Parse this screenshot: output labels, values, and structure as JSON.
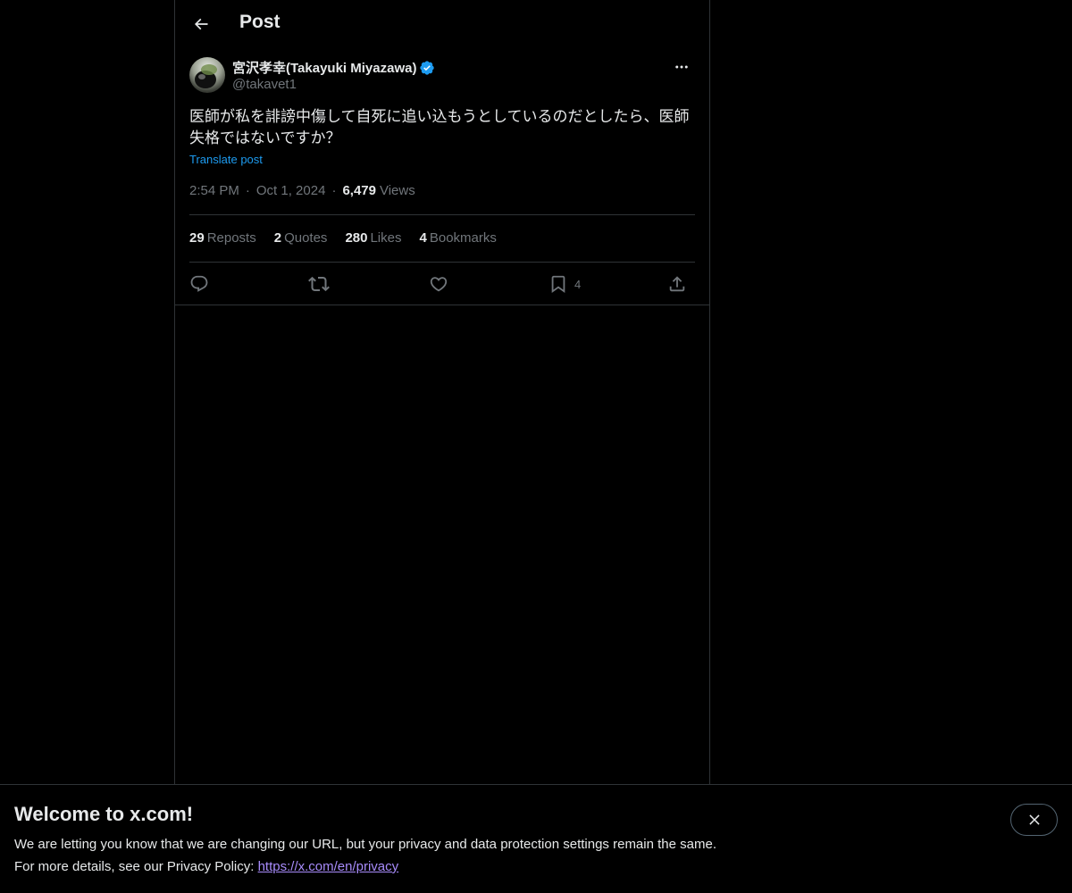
{
  "header": {
    "title": "Post",
    "back_icon": "arrow-left-icon"
  },
  "post": {
    "author": {
      "display_name": "宮沢孝幸(Takayuki Miyazawa)",
      "handle": "@takavet1",
      "verified": true,
      "verified_color": "#1d9bf0"
    },
    "text_line1": "医師が私を誹謗中傷して自死に追い込もうとしているのだとしたら、医師",
    "text_line2": "失格ではないですか？",
    "translate_label": "Translate post",
    "time": "2:54 PM",
    "date": "Oct 1, 2024",
    "views_count": "6,479",
    "views_label": "Views",
    "separator": "·"
  },
  "stats": [
    {
      "count": "29",
      "label": "Reposts"
    },
    {
      "count": "2",
      "label": "Quotes"
    },
    {
      "count": "280",
      "label": "Likes"
    },
    {
      "count": "4",
      "label": "Bookmarks"
    }
  ],
  "actions": {
    "reply_icon": "reply-icon",
    "repost_icon": "repost-icon",
    "like_icon": "heart-icon",
    "bookmark_icon": "bookmark-icon",
    "bookmark_count": "4",
    "share_icon": "share-icon"
  },
  "banner": {
    "title": "Welcome to x.com!",
    "line1": "We are letting you know that we are changing our URL, but your privacy and data protection settings remain the same.",
    "line2_prefix": "For more details, see our Privacy Policy: ",
    "link_text": "https://x.com/en/privacy",
    "link_color": "#a78bfa",
    "close_icon": "close-icon"
  },
  "colors": {
    "background": "#000000",
    "text_primary": "#e7e9ea",
    "text_secondary": "#71767b",
    "accent": "#1d9bf0",
    "border": "#2f3336"
  }
}
